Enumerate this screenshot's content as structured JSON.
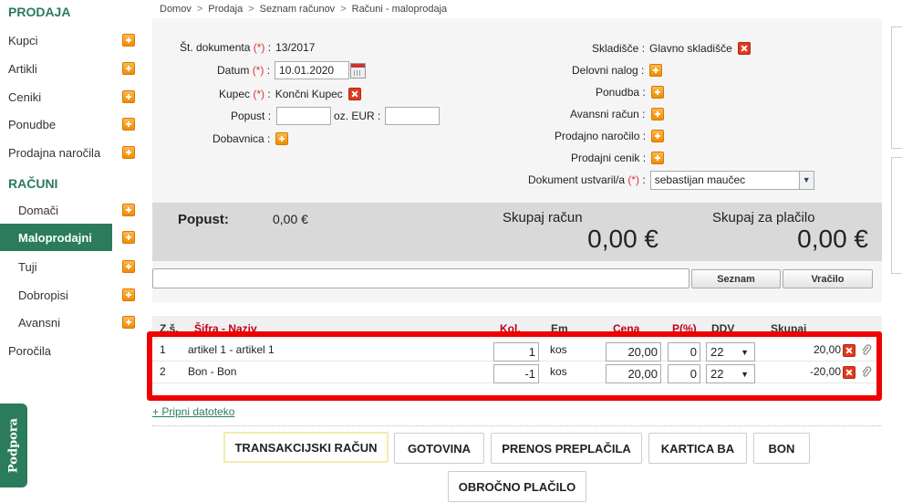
{
  "sidebar": {
    "sections": [
      {
        "title": "PRODAJA"
      },
      {
        "title": "RAČUNI"
      }
    ],
    "prodaja_items": [
      "Kupci",
      "Artikli",
      "Ceniki",
      "Ponudbe",
      "Prodajna naročila"
    ],
    "racuni_items": [
      "Domači",
      "Maloprodajni",
      "Tuji",
      "Dobropisi",
      "Avansni"
    ],
    "active_item": "Maloprodajni",
    "porocila": "Poročila",
    "support_tab": "Podpora",
    "accent_color": "#2a7c5c"
  },
  "breadcrumb": [
    "Domov",
    "Prodaja",
    "Seznam računov",
    "Računi - maloprodaja"
  ],
  "form": {
    "doc_label": "Št. dokumenta",
    "doc_value": "13/2017",
    "date_label": "Datum",
    "date_value": "10.01.2020",
    "customer_label": "Kupec",
    "customer_value": "Končni Kupec",
    "discount_label": "Popust :",
    "discount_value": "",
    "eur_label": "oz. EUR :",
    "eur_value": "",
    "delivery_label": "Dobavnica :",
    "warehouse_label": "Skladišče :",
    "warehouse_value": "Glavno skladišče",
    "work_order_label": "Delovni nalog :",
    "offer_label": "Ponudba :",
    "advance_label": "Avansni račun :",
    "sales_order_label": "Prodajno naročilo :",
    "price_list_label": "Prodajni cenik :",
    "created_by_label": "Dokument ustvaril/a",
    "created_by_value": "sebastijan maučec",
    "required_mark": "(*)",
    "colon": ":"
  },
  "totals": {
    "discount_label": "Popust:",
    "discount_value": "0,00 €",
    "total_label": "Skupaj račun",
    "total_value": "0,00 €",
    "pay_label": "Skupaj za plačilo",
    "pay_value": "0,00 €"
  },
  "search": {
    "value": "",
    "list_button": "Seznam",
    "return_button": "Vračilo"
  },
  "table": {
    "headers": {
      "num": "Z.š.",
      "code_name": "Šifra - Naziv",
      "qty": "Kol.",
      "unit": "Em",
      "price": "Cena",
      "discount": "P(%)",
      "vat": "DDV",
      "total": "Skupaj"
    },
    "rows": [
      {
        "num": "1",
        "name": "artikel 1 - artikel 1",
        "qty": "1",
        "unit": "kos",
        "price": "20,00",
        "discount": "0",
        "vat": "22",
        "total": "20,00"
      },
      {
        "num": "2",
        "name": "Bon - Bon",
        "qty": "-1",
        "unit": "kos",
        "price": "20,00",
        "discount": "0",
        "vat": "22",
        "total": "-20,00"
      }
    ]
  },
  "attach_link": "+ Pripni datoteko",
  "payment_buttons": [
    "TRANSAKCIJSKI RAČUN",
    "GOTOVINA",
    "PRENOS PREPLAČILA",
    "KARTICA BA",
    "BON",
    "OBROČNO PLAČILO"
  ],
  "icons": {
    "add": "plus-icon",
    "remove": "remove-x-icon",
    "calendar": "calendar-icon",
    "attach": "paperclip-icon",
    "dropdown": "chevron-down-icon"
  }
}
